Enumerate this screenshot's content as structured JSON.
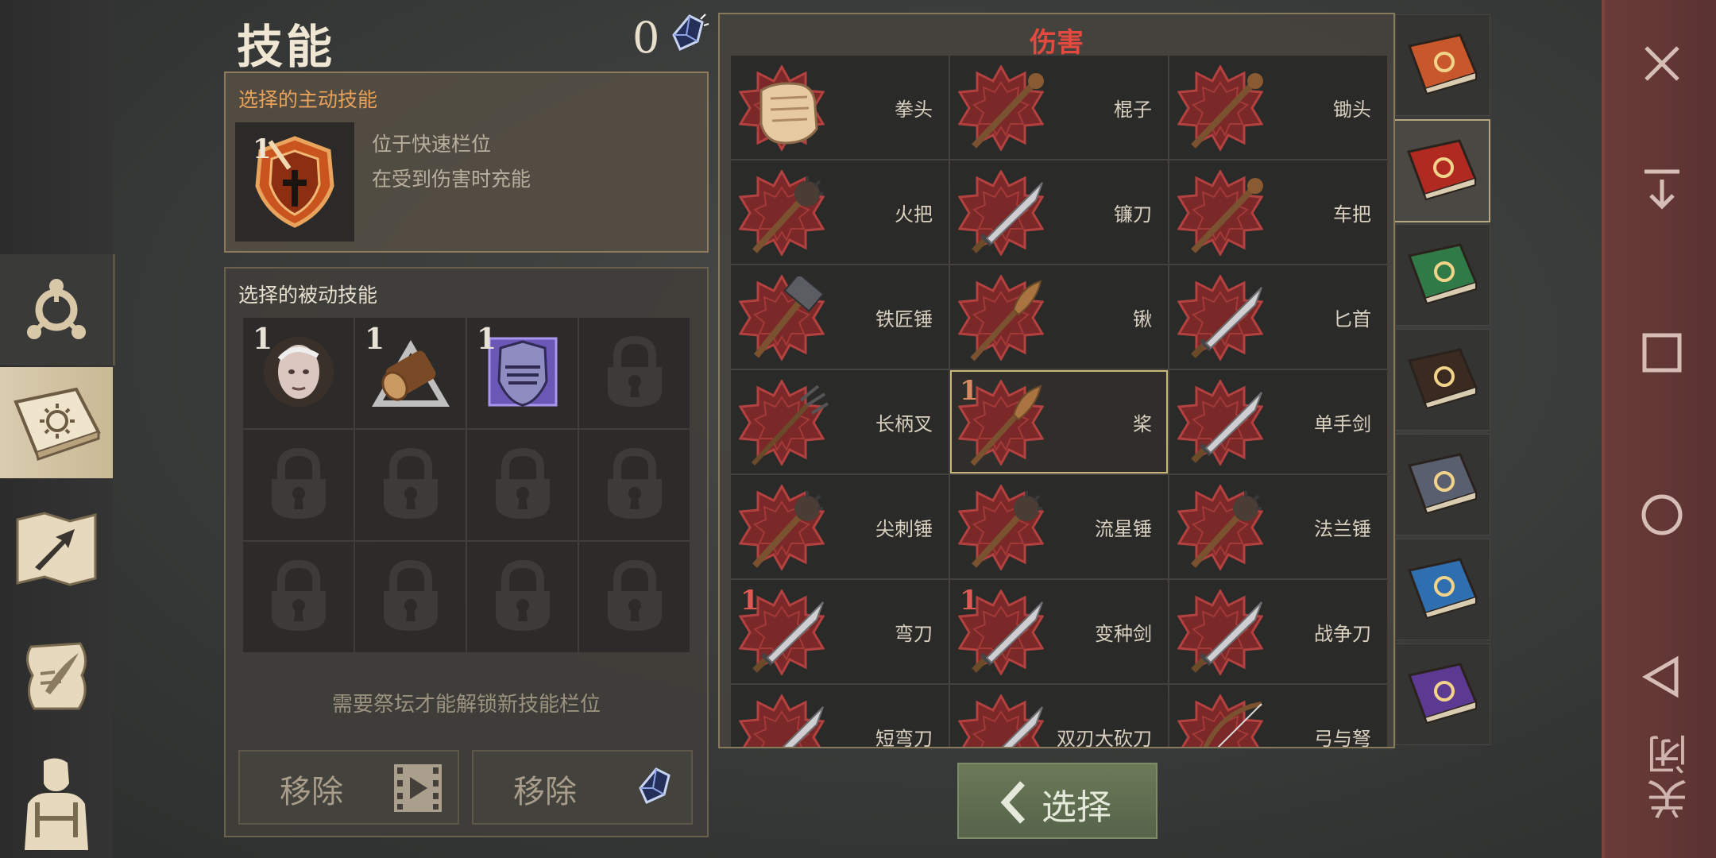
{
  "header": {
    "title": "技能",
    "points": "0"
  },
  "active_skill": {
    "heading": "选择的主动技能",
    "level": "1",
    "desc_line1": "位于快速栏位",
    "desc_line2": "在受到伤害时充能"
  },
  "passive_skills": {
    "heading": "选择的被动技能",
    "slots": [
      {
        "level": "1",
        "icon": "bald-head-icon"
      },
      {
        "level": "1",
        "icon": "log-icon"
      },
      {
        "level": "1",
        "icon": "knight-helmet-icon"
      },
      {
        "level": "",
        "icon": "lock-icon"
      },
      {
        "level": "",
        "icon": "lock-icon"
      },
      {
        "level": "",
        "icon": "lock-icon"
      },
      {
        "level": "",
        "icon": "lock-icon"
      },
      {
        "level": "",
        "icon": "lock-icon"
      },
      {
        "level": "",
        "icon": "lock-icon"
      },
      {
        "level": "",
        "icon": "lock-icon"
      },
      {
        "level": "",
        "icon": "lock-icon"
      },
      {
        "level": "",
        "icon": "lock-icon"
      }
    ],
    "unlock_note": "需要祭坛才能解锁新技能栏位",
    "remove_video_label": "移除",
    "remove_crystal_label": "移除"
  },
  "damage": {
    "title": "伤害",
    "items": [
      {
        "label": "拳头",
        "level": ""
      },
      {
        "label": "棍子",
        "level": ""
      },
      {
        "label": "锄头",
        "level": ""
      },
      {
        "label": "火把",
        "level": ""
      },
      {
        "label": "镰刀",
        "level": ""
      },
      {
        "label": "车把",
        "level": ""
      },
      {
        "label": "铁匠锤",
        "level": ""
      },
      {
        "label": "锹",
        "level": ""
      },
      {
        "label": "匕首",
        "level": ""
      },
      {
        "label": "长柄叉",
        "level": ""
      },
      {
        "label": "桨",
        "level": "1"
      },
      {
        "label": "单手剑",
        "level": ""
      },
      {
        "label": "尖刺锤",
        "level": ""
      },
      {
        "label": "流星锤",
        "level": ""
      },
      {
        "label": "法兰锤",
        "level": ""
      },
      {
        "label": "弯刀",
        "level": "1"
      },
      {
        "label": "变种剑",
        "level": "1"
      },
      {
        "label": "战争刀",
        "level": ""
      },
      {
        "label": "短弯刀",
        "level": ""
      },
      {
        "label": "双刃大砍刀",
        "level": ""
      },
      {
        "label": "弓与弩",
        "level": ""
      }
    ]
  },
  "book_tabs": [
    "sun-book-icon",
    "dagger-book-icon",
    "cross-book-icon",
    "mask-book-icon",
    "pickaxe-book-icon",
    "shield-book-icon",
    "arrows-book-icon"
  ],
  "select_button": {
    "label": "选择"
  },
  "system": {
    "close_label": "关闭"
  },
  "colors": {
    "accent_red": "#e24a3f",
    "active_heading": "#e8a25a",
    "select_green": "#5f6e50"
  }
}
